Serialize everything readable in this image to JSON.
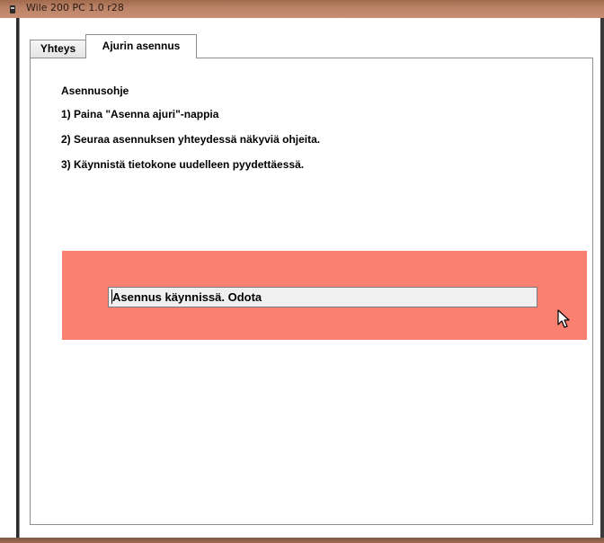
{
  "window": {
    "title": "Wile 200 PC 1.0 r28",
    "icon": "app-icon"
  },
  "tabs": [
    {
      "label": "Yhteys",
      "selected": false
    },
    {
      "label": "Ajurin asennus",
      "selected": true
    }
  ],
  "instructions": {
    "title": "Asennusohje",
    "steps": [
      "1) Paina \"Asenna ajuri\"-nappia",
      "2) Seuraa asennuksen yhteydessä näkyviä ohjeita.",
      "3) Käynnistä tietokone uudelleen pyydettäessä."
    ]
  },
  "status": {
    "value": "Asennus käynnissä. Odota",
    "background_color": "#fa8072"
  },
  "colors": {
    "titlebar": "#b98166",
    "panel_border": "#8e8f8f"
  },
  "cursor": {
    "icon": "mouse-pointer-icon"
  }
}
